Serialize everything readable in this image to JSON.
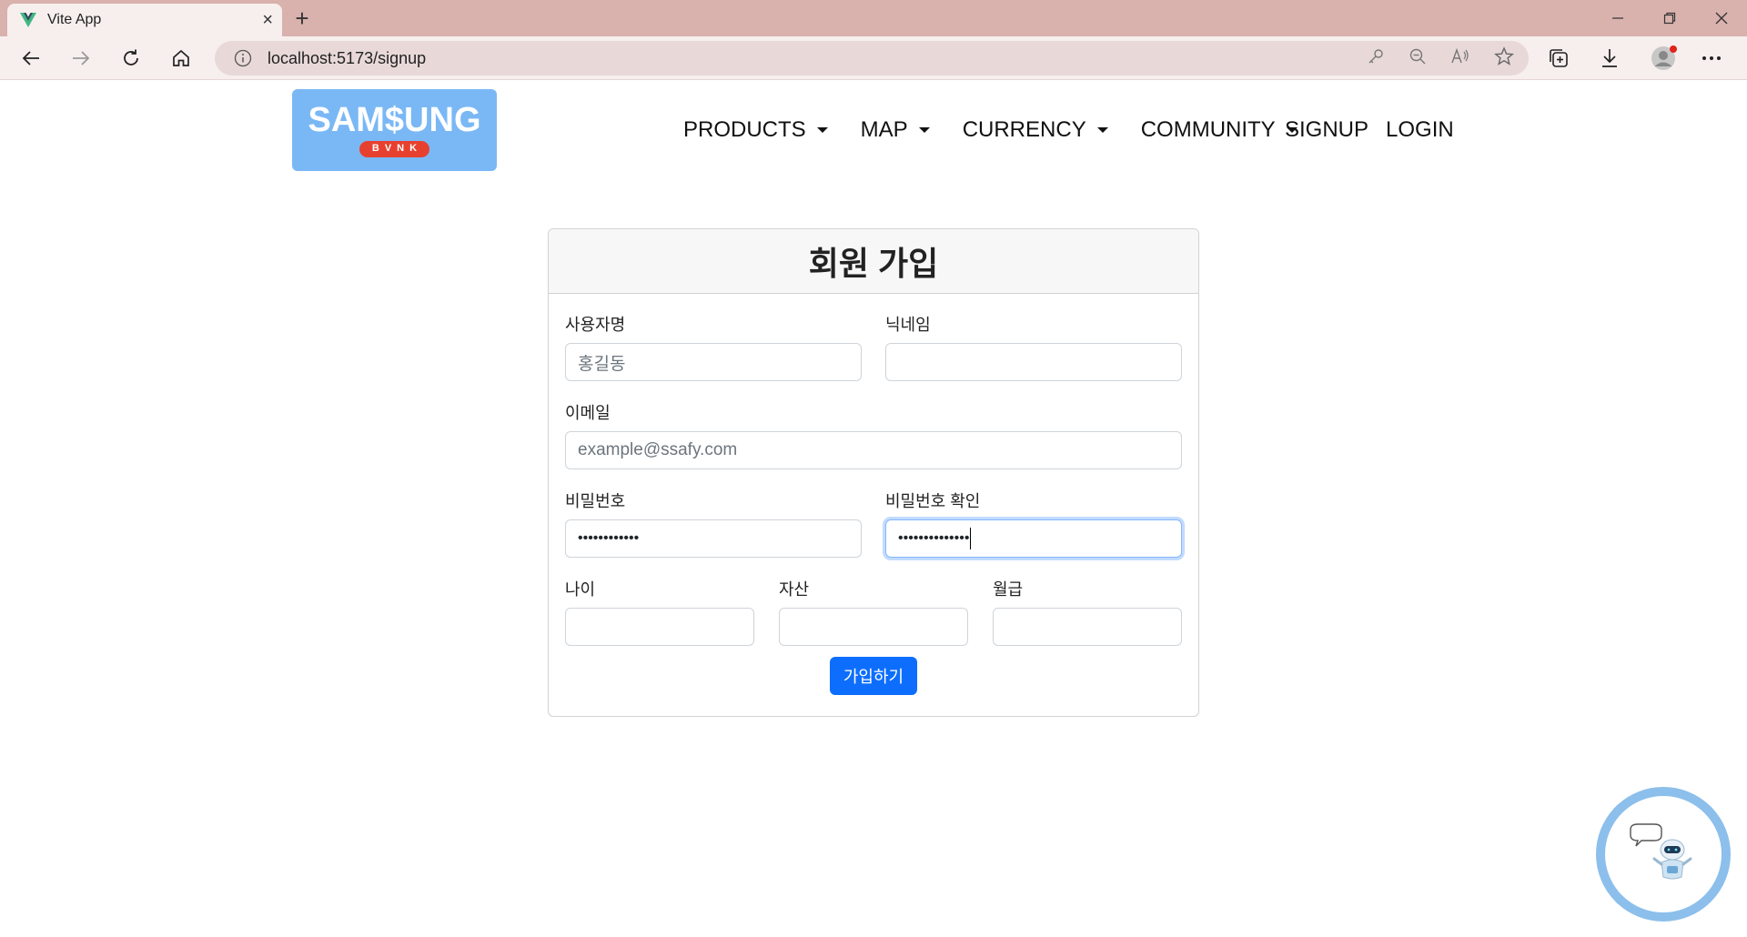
{
  "browser": {
    "tab_title": "Vite App",
    "url": "localhost:5173/signup",
    "icons": [
      "vue-favicon",
      "close-icon",
      "plus-icon",
      "minimize-icon",
      "restore-icon",
      "close-window-icon",
      "back-arrow-icon",
      "forward-arrow-icon",
      "reload-icon",
      "home-icon",
      "info-icon",
      "key-icon",
      "zoom-out-icon",
      "read-aloud-icon",
      "star-icon",
      "collections-icon",
      "download-icon",
      "profile-icon",
      "more-icon"
    ]
  },
  "header": {
    "logo_text": "SAM$UNG",
    "logo_sub": "BVNK",
    "nav": [
      "PRODUCTS",
      "MAP",
      "CURRENCY",
      "COMMUNITY"
    ],
    "signup": "SIGNUP",
    "login": "LOGIN"
  },
  "form": {
    "title": "회원 가입",
    "username_label": "사용자명",
    "username_placeholder": "홍길동",
    "nickname_label": "닉네임",
    "nickname_value": "",
    "email_label": "이메일",
    "email_placeholder": "example@ssafy.com",
    "password_label": "비밀번호",
    "password_value": "••••••••••••",
    "password_confirm_label": "비밀번호 확인",
    "password_confirm_value": "••••••••••••••",
    "age_label": "나이",
    "assets_label": "자산",
    "salary_label": "월급",
    "submit_label": "가입하기"
  },
  "colors": {
    "accent": "#0d6efd",
    "logo_bg": "#7ab8f5",
    "logo_badge": "#e8402f",
    "tabbar": "#d9b1ad",
    "chatbot_ring": "#8cbfeb"
  }
}
